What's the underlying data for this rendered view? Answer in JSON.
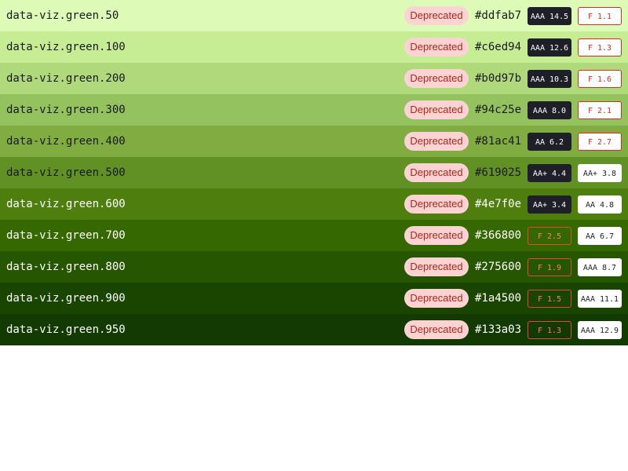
{
  "rows": [
    {
      "name": "data-viz.green.50",
      "badge": "Deprecated",
      "hex": "#ddfab7",
      "bg": "#ddfab7",
      "text_color": "#1a1a1a",
      "on_dark": "AAA 14.5",
      "on_dark_pass": true,
      "on_light": "F 1.1",
      "on_light_pass": false
    },
    {
      "name": "data-viz.green.100",
      "badge": "Deprecated",
      "hex": "#c6ed94",
      "bg": "#c6ed94",
      "text_color": "#1a1a1a",
      "on_dark": "AAA 12.6",
      "on_dark_pass": true,
      "on_light": "F 1.3",
      "on_light_pass": false
    },
    {
      "name": "data-viz.green.200",
      "badge": "Deprecated",
      "hex": "#b0d97b",
      "bg": "#b0d97b",
      "text_color": "#1a1a1a",
      "on_dark": "AAA 10.3",
      "on_dark_pass": true,
      "on_light": "F 1.6",
      "on_light_pass": false
    },
    {
      "name": "data-viz.green.300",
      "badge": "Deprecated",
      "hex": "#94c25e",
      "bg": "#94c25e",
      "text_color": "#1a1a1a",
      "on_dark": "AAA 8.0",
      "on_dark_pass": true,
      "on_light": "F 2.1",
      "on_light_pass": false
    },
    {
      "name": "data-viz.green.400",
      "badge": "Deprecated",
      "hex": "#81ac41",
      "bg": "#81ac41",
      "text_color": "#1a1a1a",
      "on_dark": "AA 6.2",
      "on_dark_pass": true,
      "on_light": "F 2.7",
      "on_light_pass": false
    },
    {
      "name": "data-viz.green.500",
      "badge": "Deprecated",
      "hex": "#619025",
      "bg": "#619025",
      "text_color": "#1a1a1a",
      "on_dark": "AA+ 4.4",
      "on_dark_pass": true,
      "on_light": "AA+ 3.8",
      "on_light_pass": true
    },
    {
      "name": "data-viz.green.600",
      "badge": "Deprecated",
      "hex": "#4e7f0e",
      "bg": "#4e7f0e",
      "text_color": "#ffffff",
      "on_dark": "AA+ 3.4",
      "on_dark_pass": true,
      "on_light": "AA 4.8",
      "on_light_pass": true
    },
    {
      "name": "data-viz.green.700",
      "badge": "Deprecated",
      "hex": "#366800",
      "bg": "#366800",
      "text_color": "#ffffff",
      "on_dark": "F 2.5",
      "on_dark_pass": false,
      "on_light": "AA 6.7",
      "on_light_pass": true
    },
    {
      "name": "data-viz.green.800",
      "badge": "Deprecated",
      "hex": "#275600",
      "bg": "#275600",
      "text_color": "#ffffff",
      "on_dark": "F 1.9",
      "on_dark_pass": false,
      "on_light": "AAA 8.7",
      "on_light_pass": true
    },
    {
      "name": "data-viz.green.900",
      "badge": "Deprecated",
      "hex": "#1a4500",
      "bg": "#1a4500",
      "text_color": "#ffffff",
      "on_dark": "F 1.5",
      "on_dark_pass": false,
      "on_light": "AAA 11.1",
      "on_light_pass": true
    },
    {
      "name": "data-viz.green.950",
      "badge": "Deprecated",
      "hex": "#133a03",
      "bg": "#133a03",
      "text_color": "#ffffff",
      "on_dark": "F 1.3",
      "on_dark_pass": false,
      "on_light": "AAA 12.9",
      "on_light_pass": true
    }
  ]
}
